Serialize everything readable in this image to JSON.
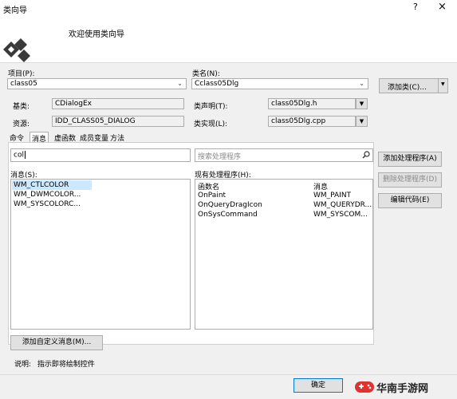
{
  "window": {
    "title": "类向导",
    "help_icon": "?",
    "close_icon": "×"
  },
  "header": {
    "welcome": "欢迎使用类向导"
  },
  "project": {
    "label": "项目(P):",
    "value": "class05"
  },
  "class_name": {
    "label": "类名(N):",
    "value": "Cclass05Dlg"
  },
  "add_class_button": {
    "label": "添加类(C)...",
    "arrow": "▼"
  },
  "base_class": {
    "label": "基类:",
    "value": "CDialogEx"
  },
  "resource": {
    "label": "资源:",
    "value": "IDD_CLASS05_DIALOG"
  },
  "class_decl": {
    "label": "类声明(T):",
    "value": "class05Dlg.h"
  },
  "class_impl": {
    "label": "类实现(L):",
    "value": "class05Dlg.cpp"
  },
  "tabs": [
    {
      "label": "命令"
    },
    {
      "label": "消息"
    },
    {
      "label": "虚函数"
    },
    {
      "label": "成员变量"
    },
    {
      "label": "方法"
    }
  ],
  "message_search": {
    "value": "col"
  },
  "handler_search": {
    "placeholder": "搜索处理程序"
  },
  "messages": {
    "label": "消息(S):",
    "items": [
      "WM_CTLCOLOR",
      "WM_DWMCOLOR...",
      "WM_SYSCOLORC..."
    ]
  },
  "handlers": {
    "label": "现有处理程序(H):",
    "col_function": "函数名",
    "col_message": "消息",
    "rows": [
      {
        "function": "OnPaint",
        "message": "WM_PAINT"
      },
      {
        "function": "OnQueryDragIcon",
        "message": "WM_QUERYDR..."
      },
      {
        "function": "OnSysCommand",
        "message": "WM_SYSCOM..."
      }
    ]
  },
  "buttons": {
    "add_handler": "添加处理程序(A)",
    "delete_handler": "删除处理程序(D)",
    "edit_code": "编辑代码(E)",
    "add_custom_message": "添加自定义消息(M)..."
  },
  "status": {
    "label": "说明:",
    "text": "指示即将绘制控件"
  },
  "ok_button": "确定",
  "watermark": {
    "text": "华南手游网"
  },
  "colors": {
    "selected_row": "#cce8ff",
    "accent": "#0078d7"
  }
}
